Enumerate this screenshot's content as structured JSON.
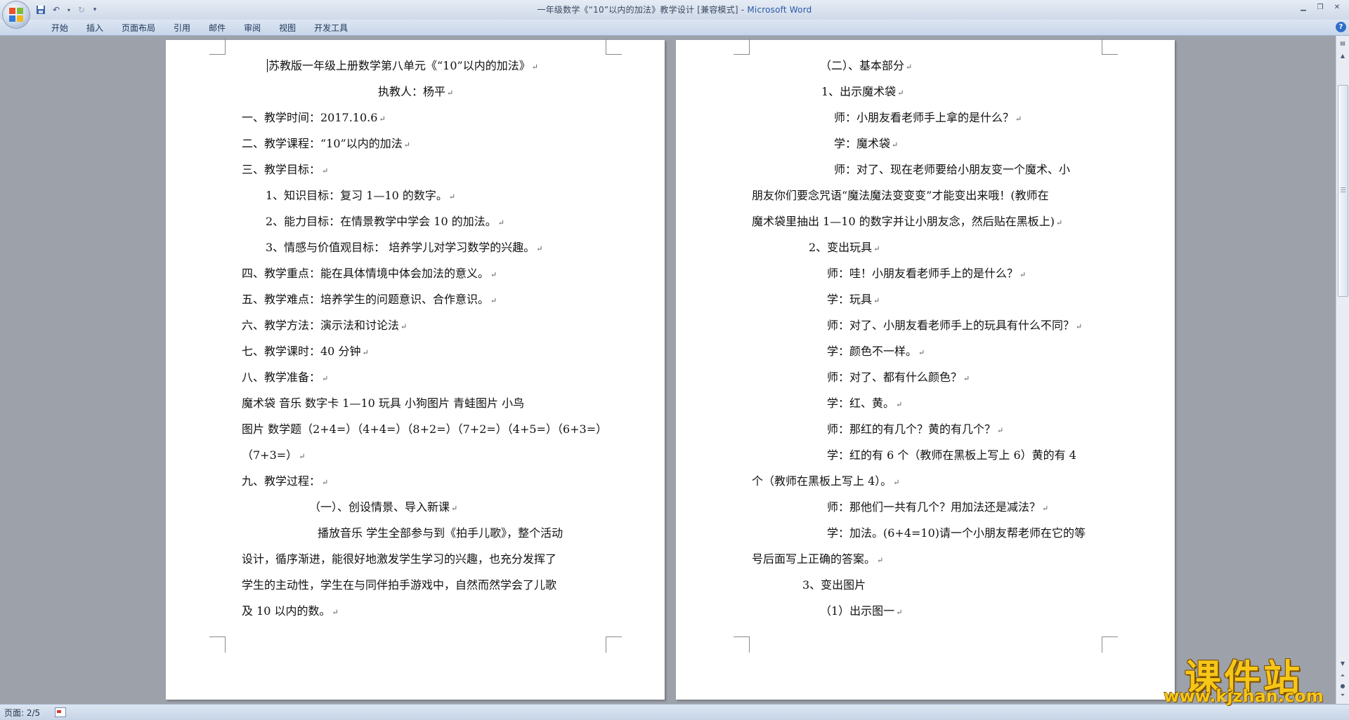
{
  "window": {
    "title_doc": "一年级数学《“10”以内的加法》教学设计 [兼容模式] - ",
    "title_app": "Microsoft Word"
  },
  "ribbon": {
    "tabs": [
      "开始",
      "插入",
      "页面布局",
      "引用",
      "邮件",
      "审阅",
      "视图",
      "开发工具"
    ]
  },
  "pages": {
    "left": [
      "苏教版一年级上册数学第八单元《“10”以内的加法》",
      "执教人：杨平",
      "一、教学时间：2017.10.6",
      "二、教学课程：“10”以内的加法",
      "三、教学目标：",
      "1、知识目标：复习 1—10 的数字。",
      "2、能力目标：在情景教学中学会 10 的加法。",
      "3、情感与价值观目标：  培养学儿对学习数学的兴趣。",
      "四、教学重点：能在具体情境中体会加法的意义。",
      "五、教学难点：培养学生的问题意识、合作意识。",
      "六、教学方法：演示法和讨论法",
      "七、教学课时：40 分钟",
      "八、教学准备：",
      "魔术袋   音乐   数字卡  1—10  玩具  小狗图片  青蛙图片   小鸟",
      "图片    数学题（2+4=）（4+4=）（8+2=）（7+2=）（4+5=）（6+3=）",
      "（7+3=）",
      "九、教学过程：",
      "（一）、创设情景、导入新课",
      "播放音乐  学生全部参与到《拍手儿歌》，整个活动",
      "设计，循序渐进，能很好地激发学生学习的兴趣，也充分发挥了",
      "学生的主动性，学生在与同伴拍手游戏中，自然而然学会了儿歌",
      "及 10 以内的数。"
    ],
    "right": [
      "（二）、基本部分",
      "1、出示魔术袋",
      "师：小朋友看老师手上拿的是什么？",
      "学：魔术袋",
      "师：对了、现在老师要给小朋友变一个魔术、小",
      "朋友你们要念咒语“魔法魔法变变变”才能变出来哦！(教师在",
      "魔术袋里抽出 1—10 的数字并让小朋友念，然后贴在黑板上)",
      "2、变出玩具",
      "师：哇！小朋友看老师手上的是什么？",
      "学：玩具",
      "师：对了、小朋友看老师手上的玩具有什么不同？",
      "学：颜色不一样。",
      "师：对了、都有什么颜色？",
      "学：红、黄。",
      "师：那红的有几个？黄的有几个？",
      "学：红的有 6 个（教师在黑板上写上 6）黄的有 4",
      "个（教师在黑板上写上 4）。",
      "师：那他们一共有几个？用加法还是减法？",
      "学：加法。(6+4=10)请一个小朋友帮老师在它的等",
      "号后面写上正确的答案。",
      "3、变出图片",
      "（1）出示图一"
    ]
  },
  "statusbar": {
    "page_info": "页面: 2/5"
  },
  "watermark": {
    "title": "课件站",
    "url": "www.kjzhan.com"
  },
  "colors": {
    "ribbon": "#c8d6ea",
    "workspace": "#9da2aa",
    "watermark": "#f6c618"
  }
}
